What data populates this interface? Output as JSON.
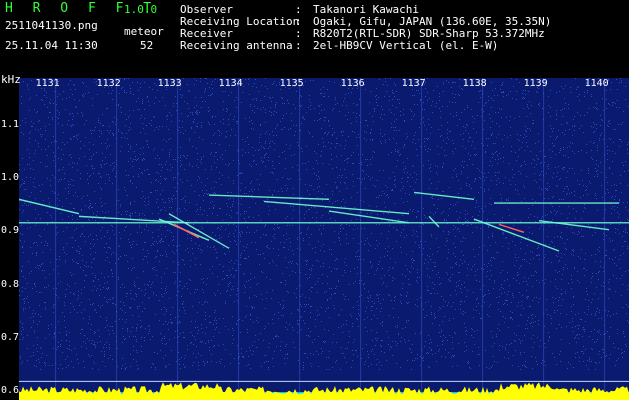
{
  "header": {
    "app_title": "H R O F F T",
    "version": "1.0.0",
    "filename": "2511041130.png",
    "datetime": "25.11.04 11:30",
    "meteor_label": "meteor",
    "meteor_count": "52",
    "info": [
      {
        "key": "Observer",
        "value": "Takanori Kawachi"
      },
      {
        "key": "Receiving Location",
        "value": "Ogaki, Gifu, JAPAN (136.60E, 35.35N)"
      },
      {
        "key": "Receiver",
        "value": "R820T2(RTL-SDR) SDR-Sharp 53.372MHz"
      },
      {
        "key": "Receiving antenna",
        "value": "2el-HB9CV Vertical (el. E-W)"
      }
    ]
  },
  "chart_data": {
    "type": "heatmap",
    "ylabel": "kHz",
    "y_ticks": [
      "1.1",
      "1.0",
      "0.9",
      "0.8",
      "0.7",
      "0.6"
    ],
    "x_ticks": [
      "1131",
      "1132",
      "1133",
      "1134",
      "1135",
      "1136",
      "1137",
      "1138",
      "1139",
      "1140"
    ],
    "ylim": [
      0.585,
      1.19
    ],
    "colors": {
      "background": "#0a1a6e",
      "noise": "#3a5adc",
      "trace": "#6fffd0",
      "strong": "#ff6060",
      "level": "#ffff00",
      "level_base": "#00c8ff"
    }
  }
}
